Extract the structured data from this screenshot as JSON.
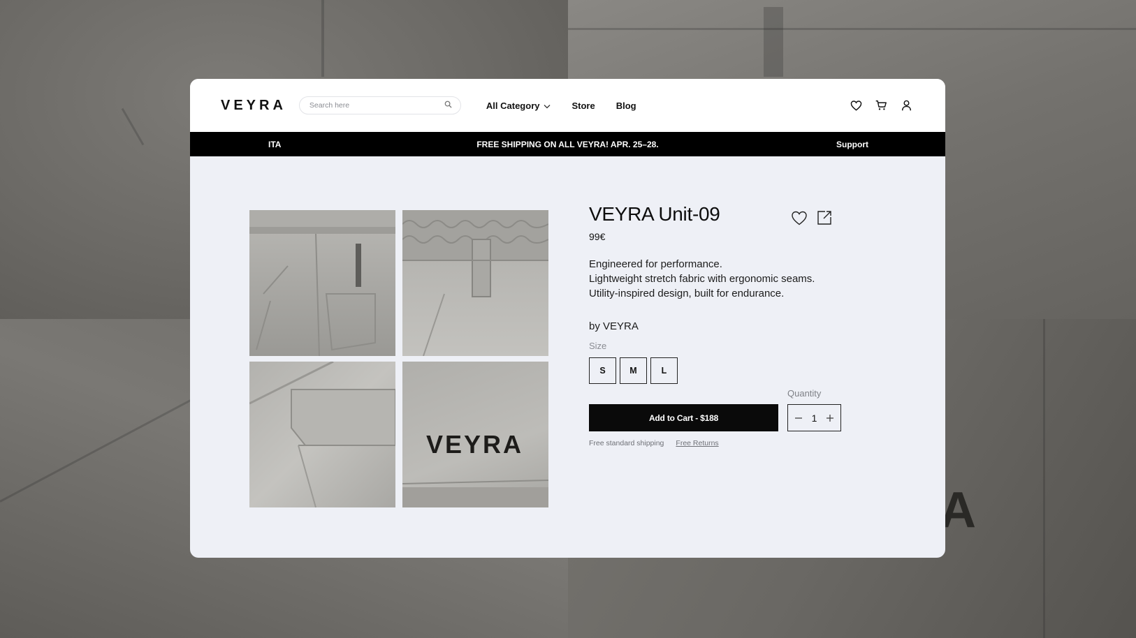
{
  "brand": {
    "logo": "VEYRA"
  },
  "search": {
    "placeholder": "Search here"
  },
  "nav": {
    "category": "All Category",
    "store": "Store",
    "blog": "Blog"
  },
  "banner": {
    "language": "ITA",
    "promo": "FREE SHIPPING ON ALL VEYRA! APR. 25–28.",
    "support": "Support"
  },
  "gallery": {
    "logo_text": "VEYRA"
  },
  "product": {
    "title": "VEYRA Unit-09",
    "price": "99€",
    "description": [
      "Engineered for performance.",
      "Lightweight stretch fabric with ergonomic seams.",
      "Utility-inspired design, built for endurance."
    ],
    "by": "by VEYRA",
    "size_label": "Size",
    "sizes": [
      "S",
      "M",
      "L"
    ],
    "add_to_cart": "Add to Cart - $188",
    "quantity_label": "Quantity",
    "quantity": "1",
    "shipping_note": "Free standard shipping",
    "returns_link": "Free Returns"
  },
  "background": {
    "logo_fragment": "A"
  },
  "icons": {
    "search": "search-icon",
    "chevron": "chevron-down-icon",
    "wishlist": "heart-icon",
    "cart": "cart-icon",
    "account": "user-icon",
    "share": "share-icon",
    "minus": "minus-icon",
    "plus": "plus-icon"
  },
  "colors": {
    "banner_bg": "#000000",
    "card_bg": "#eef0f6",
    "button_bg": "#0a0a0a"
  }
}
